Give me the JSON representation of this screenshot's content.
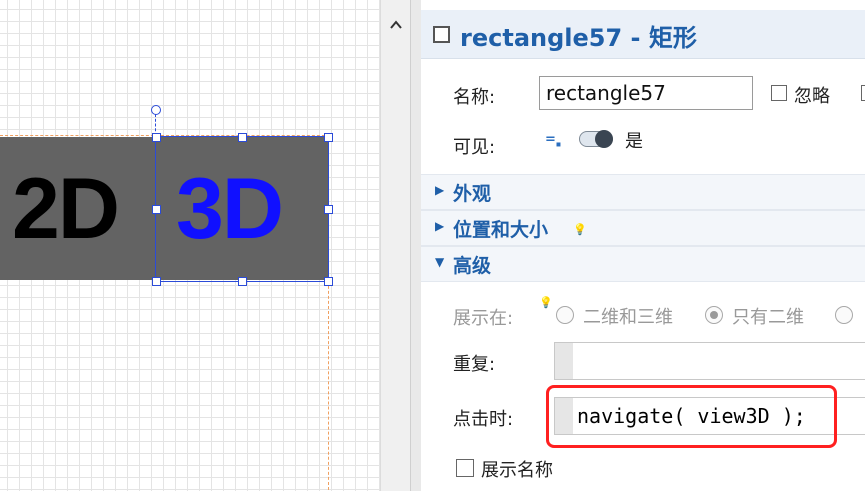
{
  "canvas": {
    "shape_left_text": "2D",
    "shape_right_text": "3D"
  },
  "panel": {
    "title": "rectangle57 - 矩形",
    "name_label": "名称:",
    "name_value": "rectangle57",
    "ignore_label": "忽略",
    "visible_label": "可见:",
    "visible_value": "是",
    "sections": {
      "appearance": "外观",
      "position_size": "位置和大小",
      "advanced": "高级"
    },
    "show_in_label": "展示在:",
    "show_in_options": [
      "二维和三维",
      "只有二维"
    ],
    "show_in_selected": "只有二维",
    "repeat_label": "重复:",
    "repeat_value": "",
    "on_click_label": "点击时:",
    "on_click_code": "navigate( view3D );",
    "show_name_label": "展示名称"
  }
}
